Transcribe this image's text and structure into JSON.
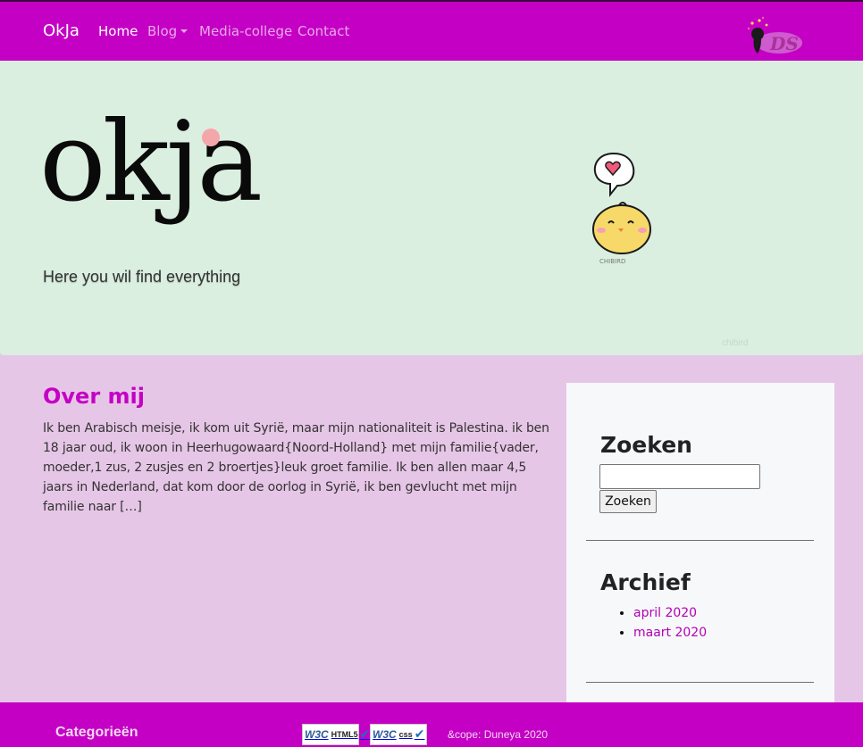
{
  "navbar": {
    "brand": "OkJa",
    "items": [
      {
        "label": "Home"
      },
      {
        "label": "Blog"
      },
      {
        "label": "Media-college"
      },
      {
        "label": "Contact"
      }
    ],
    "logo_text": "DS"
  },
  "hero": {
    "title": "okja",
    "subtitle": "Here you wil find everything",
    "watermark": "chibird",
    "chick_label": "CHIBIRD"
  },
  "post": {
    "title": "Over mij",
    "excerpt": "Ik ben Arabisch meisje, ik kom uit Syrië, maar mijn nationaliteit is Palestina. ik ben 18 jaar oud, ik woon in Heerhugowaard{Noord-Holland} met mijn familie{vader, moeder,1 zus, 2 zusjes en 2 broertjes}leuk groet familie. Ik ben allen maar 4,5 jaars in Nederland, dat kom door de oorlog in Syrië, ik ben gevlucht met mijn familie naar […]"
  },
  "sidebar": {
    "search_title": "Zoeken",
    "search_value": "",
    "search_button": "Zoeken",
    "archive_title": "Archief",
    "archive_items": [
      {
        "label": "april 2020"
      },
      {
        "label": "maart 2020"
      }
    ]
  },
  "footer": {
    "heading": "Categorieën",
    "badge_html": {
      "w3c": "W3C",
      "kind": "HTML5"
    },
    "badge_css": {
      "w3c": "W3C",
      "kind": "css"
    },
    "copyright": "&cope: Duneya 2020"
  },
  "colors": {
    "brand": "#c400c4",
    "hero_bg": "#daefe0",
    "page_bg": "#e6c6e6",
    "sidebar_bg": "#f7f8fa",
    "dot": "#f4a7aa"
  }
}
